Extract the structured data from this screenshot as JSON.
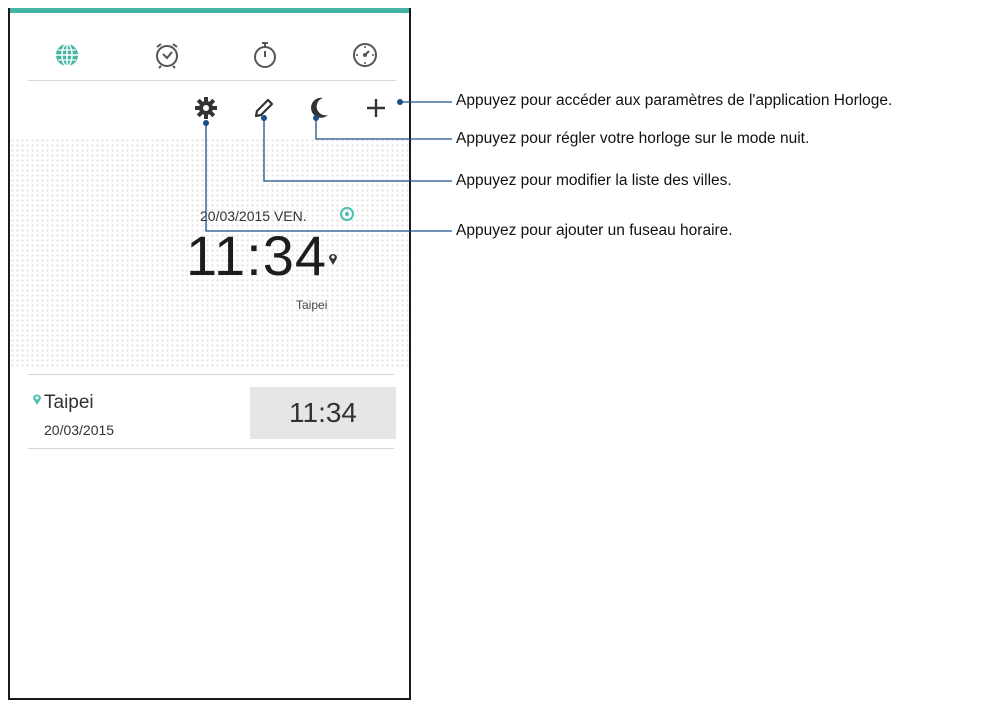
{
  "tabs": [
    {
      "name": "world-clock",
      "icon": "globe-icon",
      "active": true
    },
    {
      "name": "alarm",
      "icon": "alarm-clock-icon",
      "active": false
    },
    {
      "name": "stopwatch",
      "icon": "stopwatch-icon",
      "active": false
    },
    {
      "name": "timer",
      "icon": "timer-icon",
      "active": false
    }
  ],
  "actions": {
    "settings_icon": "gear-icon",
    "edit_icon": "pencil-icon",
    "night_icon": "moon-icon",
    "add_icon": "plus-icon"
  },
  "clock": {
    "date": "20/03/2015 VEN.",
    "time": "11:34",
    "city": "Taipei"
  },
  "list": [
    {
      "city": "Taipei",
      "date": "20/03/2015",
      "time": "11:34"
    }
  ],
  "callouts": {
    "add": "Appuyez pour accéder aux paramètres de l'application Horloge.",
    "night": "Appuyez pour régler votre horloge sur le mode nuit.",
    "edit": "Appuyez pour modifier la liste des villes.",
    "settings": "Appuyez pour ajouter un fuseau horaire."
  },
  "colors": {
    "accent": "#44b5a4",
    "callout_line": "#1c4f8a"
  }
}
